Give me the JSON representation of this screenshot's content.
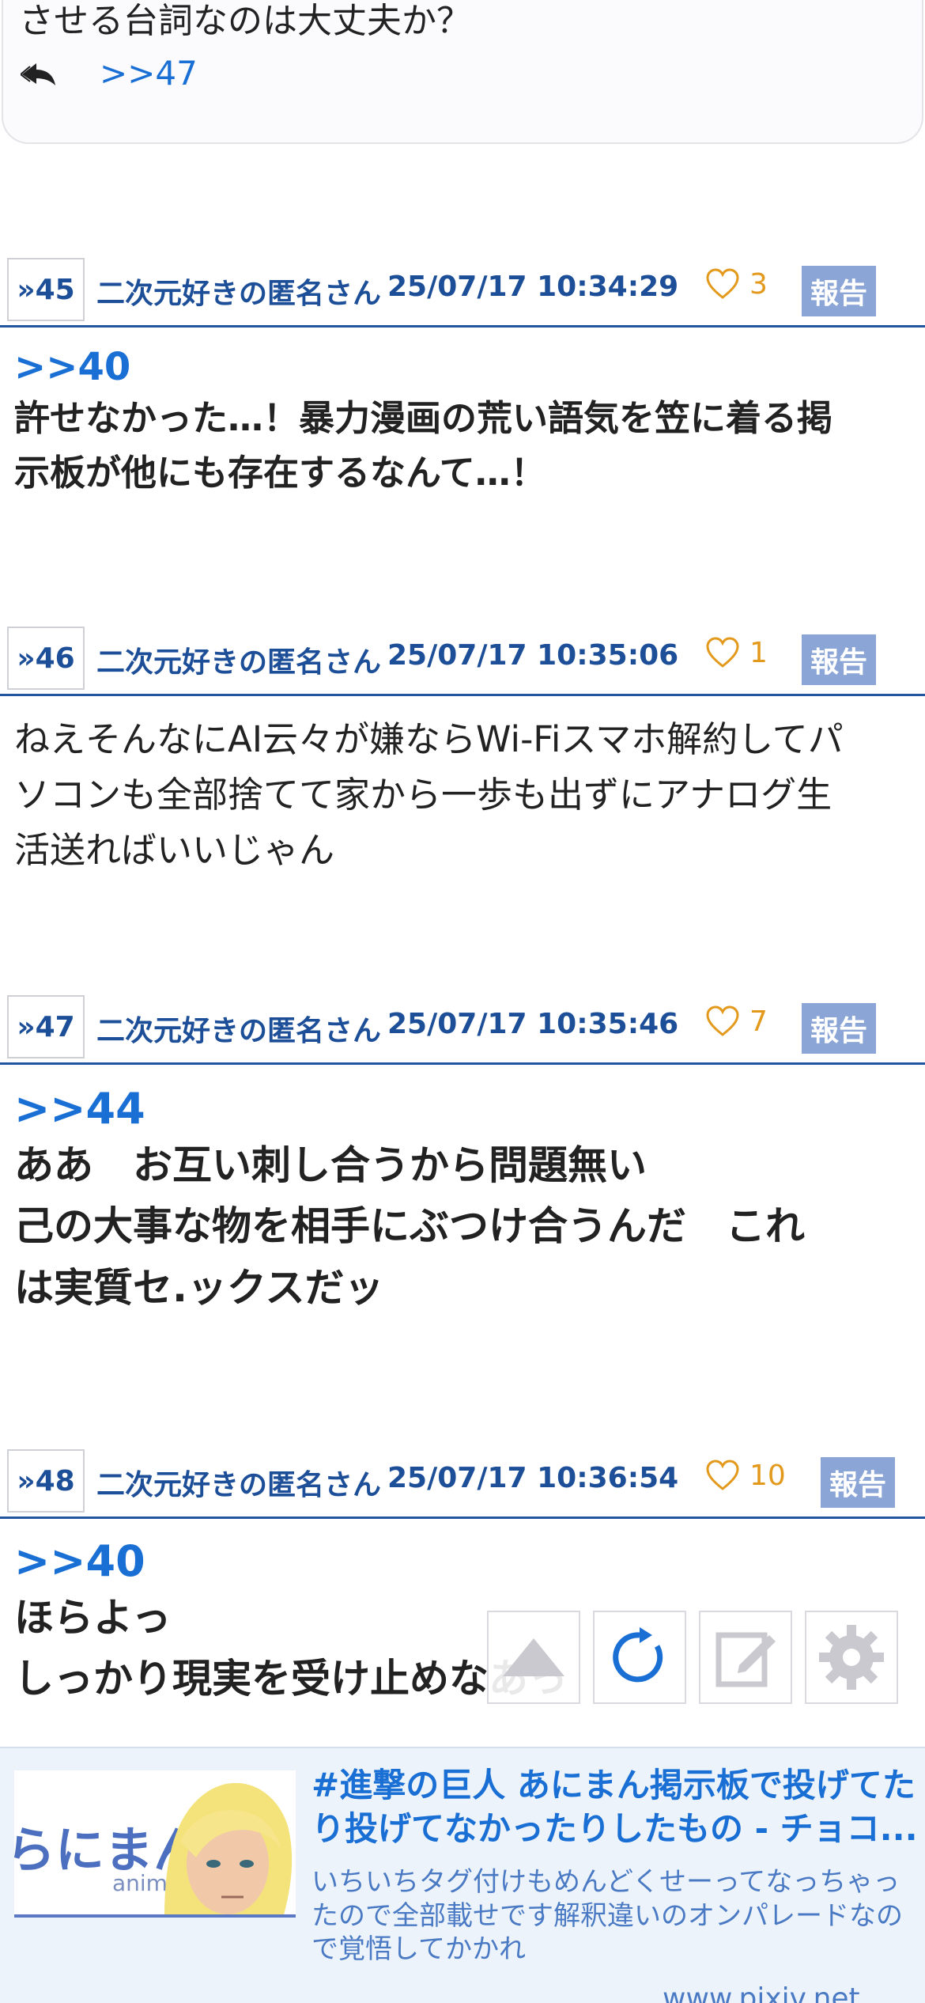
{
  "top_post": {
    "text_partial": "させる台詞なのは大丈夫か？",
    "reply_link": ">>47"
  },
  "posts": [
    {
      "number": "»45",
      "author": "二次元好きの匿名さん",
      "datetime": "25/07/17 10:34:29",
      "likes": "3",
      "report": "報告",
      "anchor": ">>40",
      "lines": [
        "許せなかった…！暴力漫画の荒い語気を笠に着る掲",
        "示板が他にも存在するなんて…！"
      ]
    },
    {
      "number": "»46",
      "author": "二次元好きの匿名さん",
      "datetime": "25/07/17 10:35:06",
      "likes": "1",
      "report": "報告",
      "anchor": "",
      "lines": [
        "ねえそんなにAI云々が嫌ならWi-Fiスマホ解約してパ",
        "ソコンも全部捨てて家から一歩も出ずにアナログ生",
        "活送ればいいじゃん"
      ]
    },
    {
      "number": "»47",
      "author": "二次元好きの匿名さん",
      "datetime": "25/07/17 10:35:46",
      "likes": "7",
      "report": "報告",
      "anchor": ">>44",
      "lines": [
        "ああ　お互い刺し合うから問題無い",
        "己の大事な物を相手にぶつけ合うんだ　これ",
        "は実質セ.ックスだッ"
      ]
    },
    {
      "number": "»48",
      "author": "二次元好きの匿名さん",
      "datetime": "25/07/17 10:36:54",
      "likes": "10",
      "report": "報告",
      "anchor": ">>40",
      "lines": [
        "ほらよっ",
        "しっかり現実を受け止めなあっ"
      ]
    }
  ],
  "floating_buttons": [
    "up-arrow-icon",
    "refresh-icon",
    "edit-icon",
    "gear-icon"
  ],
  "ad": {
    "thumb_text": "らにまん",
    "thumb_sub": "anim",
    "title": "#進撃の巨人 あにまん掲示板で投げてたり投げてなかったりしたもの - チョコ...",
    "description": "いちいちタグ付けもめんどくせーってなっちゃったので全部載せです解釈違いのオンパレードなので覚悟してかかれ",
    "domain": "www.pixiv.net"
  },
  "colors": {
    "link_blue": "#1a6fd4",
    "header_blue": "#1d4f99",
    "like_orange": "#e39a1c",
    "report_bg": "#8aa5d6"
  }
}
